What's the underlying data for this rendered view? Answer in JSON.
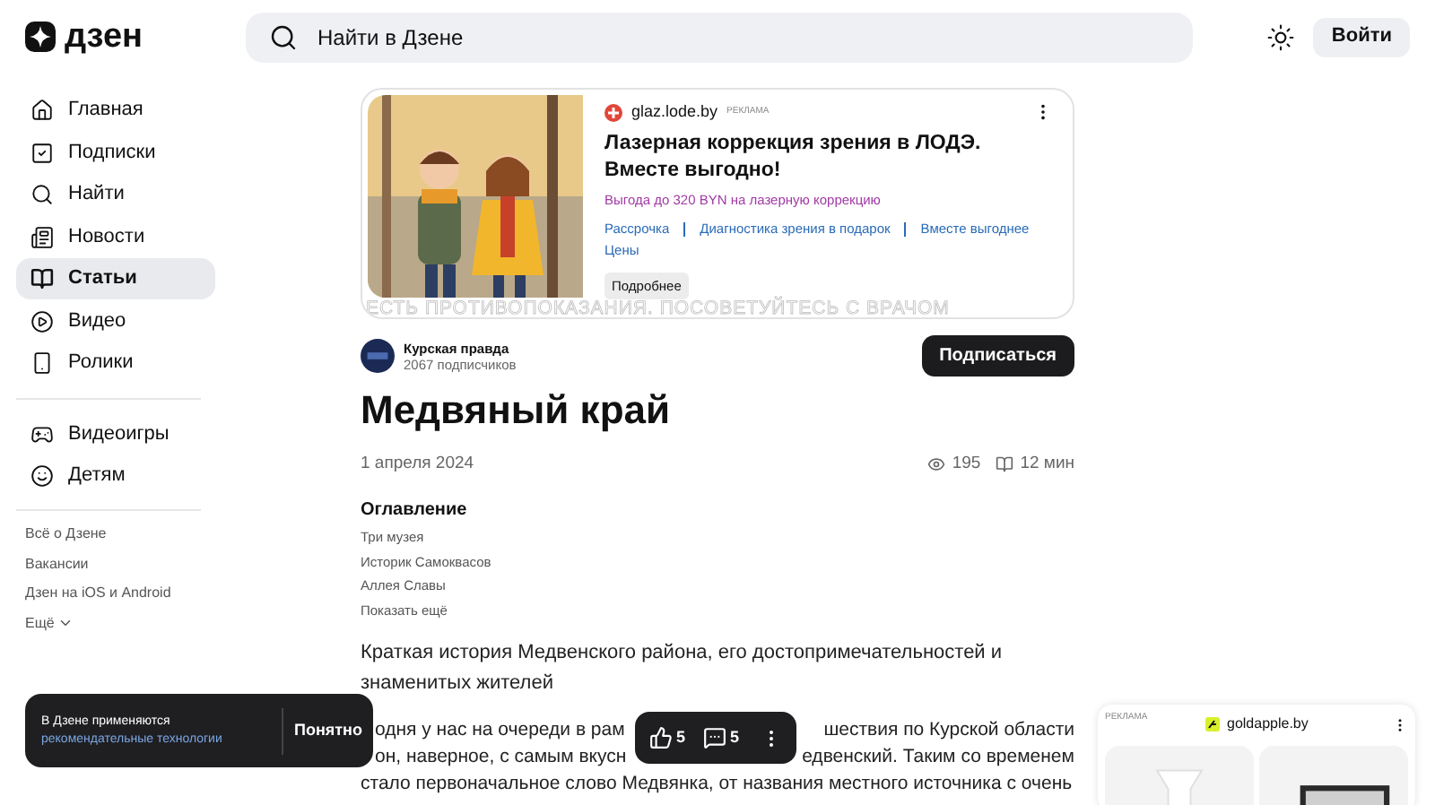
{
  "header": {
    "logo": "дзен",
    "search": {
      "placeholder": "Найти в Дзене"
    },
    "login": "Войти"
  },
  "sidebar": {
    "items": [
      {
        "label": "Главная",
        "selected": false
      },
      {
        "label": "Подписки",
        "selected": false
      },
      {
        "label": "Найти",
        "selected": false
      },
      {
        "label": "Новости",
        "selected": false
      },
      {
        "label": "Статьи",
        "selected": true
      },
      {
        "label": "Видео",
        "selected": false
      },
      {
        "label": "Ролики",
        "selected": false
      }
    ],
    "extra": [
      {
        "label": "Видеоигры"
      },
      {
        "label": "Детям"
      }
    ],
    "links": [
      "Всё о Дзене",
      "Вакансии",
      "Дзен на iOS и Android"
    ],
    "more": "Ещё"
  },
  "ad": {
    "domain": "glaz.lode.by",
    "badge": "РЕКЛАМА",
    "title": "Лазерная коррекция зрения в ЛОДЭ. Вместе выгодно!",
    "offer": "Выгода до 320 BYN на лазерную коррекцию",
    "links": [
      "Рассрочка",
      "Диагностика зрения в подарок",
      "Вместе выгоднее",
      "Цены"
    ],
    "button": "Подробнее",
    "disclaimer": "ЕСТЬ ПРОТИВОПОКАЗАНИЯ. ПОСОВЕТУЙТЕСЬ С ВРАЧОМ"
  },
  "channel": {
    "name": "Курская правда",
    "subscribers": "2067 подписчиков",
    "subscribe": "Подписаться"
  },
  "article": {
    "title": "Медвяный край",
    "date": "1 апреля 2024",
    "views": "195",
    "read_time": "12 мин",
    "toc": {
      "heading": "Оглавление",
      "items": [
        "Три музея",
        "Историк Самоквасов",
        "Аллея Славы"
      ],
      "more": "Показать ещё"
    },
    "lead": "Краткая история Медвенского района, его достопримечательностей и знаменитых жителей",
    "body_lines": [
      [
        "одня у нас на очереди в рам",
        "шествия по Курской области"
      ],
      [
        "он, наверное, с самым вкусн",
        "едвенский. Таким со временем"
      ],
      [
        "стало первоначальное слово Медвянка, от названия местного источника с очень"
      ]
    ]
  },
  "reactions": {
    "likes": "5",
    "comments": "5"
  },
  "cookie": {
    "text": "В Дзене применяются",
    "link": "рекомендательные технологии",
    "button": "Понятно"
  },
  "side_ad": {
    "badge": "РЕКЛАМА",
    "domain": "goldapple.by"
  }
}
